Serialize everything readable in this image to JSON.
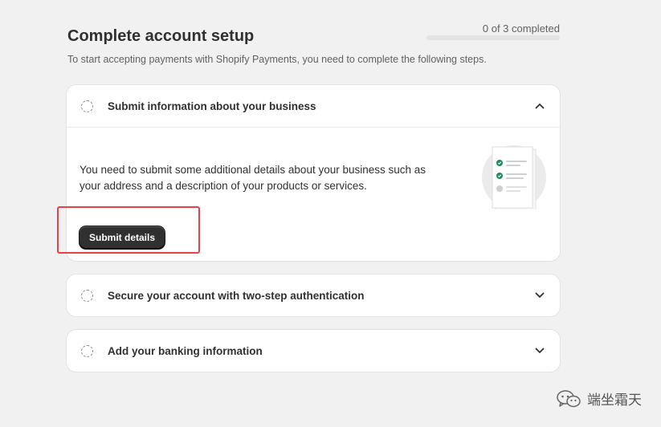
{
  "header": {
    "title": "Complete account setup",
    "subtitle": "To start accepting payments with Shopify Payments, you need to complete the following steps.",
    "progress_text": "0 of 3 completed",
    "progress_fraction": 0
  },
  "steps": [
    {
      "title": "Submit information about your business",
      "expanded": true,
      "body": "You need to submit some additional details about your business such as your address and a description of your products or services.",
      "button_label": "Submit details"
    },
    {
      "title": "Secure your account with two-step authentication",
      "expanded": false
    },
    {
      "title": "Add your banking information",
      "expanded": false
    }
  ],
  "annotation": {
    "color": "#e8404a"
  },
  "watermark": {
    "text": "端坐霜天",
    "icon": "wechat-icon"
  },
  "colors": {
    "accent": "#303030",
    "check": "#1f8a5b"
  }
}
